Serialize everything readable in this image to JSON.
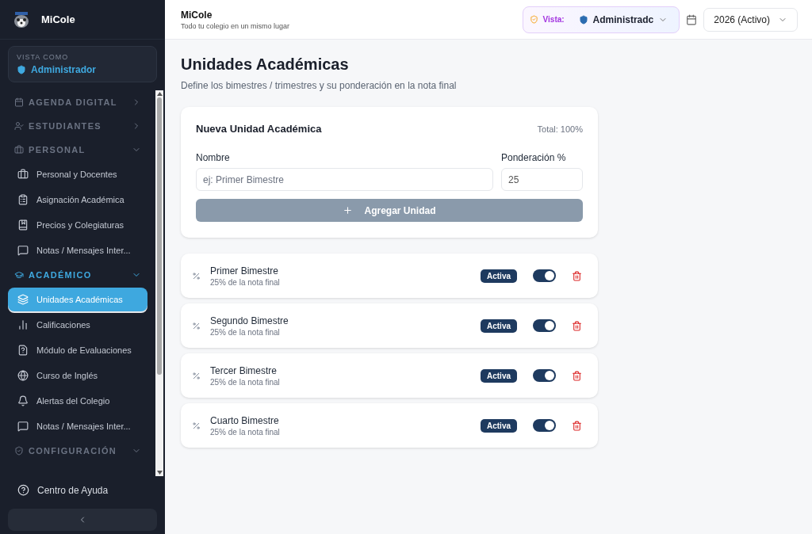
{
  "brand": {
    "name": "MiCole"
  },
  "view_as": {
    "label": "VISTA COMO",
    "role": "Administrador"
  },
  "nav": [
    {
      "label": "AGENDA DIGITAL",
      "expanded": false
    },
    {
      "label": "ESTUDIANTES",
      "expanded": false
    },
    {
      "label": "PERSONAL",
      "expanded": true,
      "children": [
        {
          "label": "Personal y Docentes",
          "selected": false
        },
        {
          "label": "Asignación Académica",
          "selected": false
        },
        {
          "label": "Precios y Colegiaturas",
          "selected": false
        },
        {
          "label": "Notas / Mensajes Inter...",
          "selected": false
        }
      ]
    },
    {
      "label": "ACADÉMICO",
      "expanded": true,
      "children": [
        {
          "label": "Unidades Académicas",
          "selected": true
        },
        {
          "label": "Calificaciones",
          "selected": false
        },
        {
          "label": "Módulo de Evaluaciones",
          "selected": false
        },
        {
          "label": "Curso de Inglés",
          "selected": false
        },
        {
          "label": "Alertas del Colegio",
          "selected": false
        },
        {
          "label": "Notas / Mensajes Inter...",
          "selected": false
        }
      ]
    },
    {
      "label": "CONFIGURACIÓN",
      "expanded": true
    }
  ],
  "help": {
    "label": "Centro de Ayuda"
  },
  "header": {
    "title": "MiCole",
    "subtitle": "Todo tu colegio en un mismo lugar",
    "view_label": "Vista:",
    "view_value": "Administradc",
    "year": "2026 (Activo)"
  },
  "page": {
    "title": "Unidades Académicas",
    "subtitle": "Define los bimestres / trimestres y su ponderación en la nota final"
  },
  "form": {
    "title": "Nueva Unidad Académica",
    "total": "Total: 100%",
    "name_label": "Nombre",
    "name_placeholder": "ej: Primer Bimestre",
    "weight_label": "Ponderación %",
    "weight_value": "25",
    "button": "Agregar Unidad",
    "disabled": true
  },
  "units": [
    {
      "name": "Primer Bimestre",
      "detail": "25% de la nota final",
      "badge": "Activa",
      "on": true
    },
    {
      "name": "Segundo Bimestre",
      "detail": "25% de la nota final",
      "badge": "Activa",
      "on": true
    },
    {
      "name": "Tercer Bimestre",
      "detail": "25% de la nota final",
      "badge": "Activa",
      "on": true
    },
    {
      "name": "Cuarto Bimestre",
      "detail": "25% de la nota final",
      "badge": "Activa",
      "on": true
    }
  ]
}
